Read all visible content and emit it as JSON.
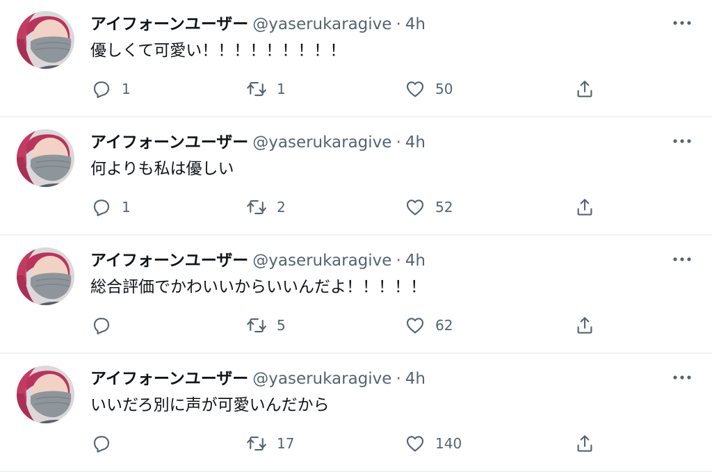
{
  "colors": {
    "text_primary": "#0f1419",
    "text_secondary": "#536471",
    "divider": "#eff3f4",
    "icon": "#536471"
  },
  "icons": {
    "reply": "reply-icon",
    "retweet": "retweet-icon",
    "like": "like-icon",
    "share": "share-icon",
    "more": "more-icon"
  },
  "tweets": [
    {
      "display_name": "アイフォーンユーザー",
      "handle": "@yaserukaragive",
      "separator": "·",
      "time": "4h",
      "text": "優しくて可愛い！！！！！！！！！",
      "replies": "1",
      "retweets": "1",
      "likes": "50"
    },
    {
      "display_name": "アイフォーンユーザー",
      "handle": "@yaserukaragive",
      "separator": "·",
      "time": "4h",
      "text": "何よりも私は優しい",
      "replies": "1",
      "retweets": "2",
      "likes": "52"
    },
    {
      "display_name": "アイフォーンユーザー",
      "handle": "@yaserukaragive",
      "separator": "·",
      "time": "4h",
      "text": "総合評価でかわいいからいいんだよ！！！！！",
      "replies": "",
      "retweets": "5",
      "likes": "62"
    },
    {
      "display_name": "アイフォーンユーザー",
      "handle": "@yaserukaragive",
      "separator": "·",
      "time": "4h",
      "text": "いいだろ別に声が可愛いんだから",
      "replies": "",
      "retweets": "17",
      "likes": "140"
    }
  ]
}
